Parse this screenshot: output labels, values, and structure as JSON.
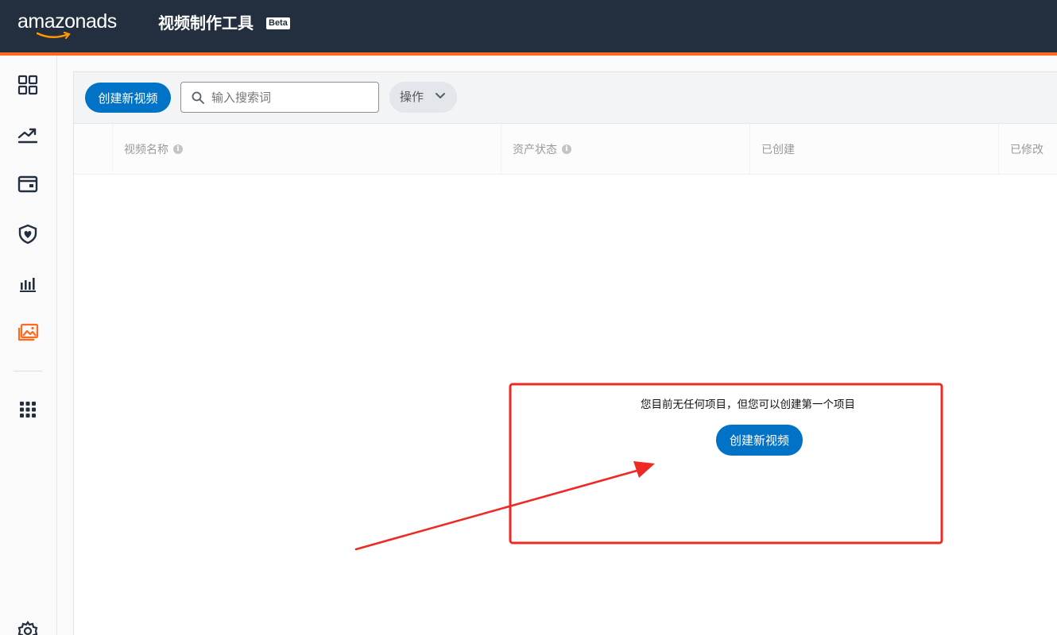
{
  "header": {
    "logo_text": "amazonads",
    "app_title": "视频制作工具",
    "beta_label": "Beta"
  },
  "sidebar": {
    "items": [
      {
        "icon": "dashboard-icon"
      },
      {
        "icon": "trending-up-icon"
      },
      {
        "icon": "wallet-icon"
      },
      {
        "icon": "brand-safety-shield-icon"
      },
      {
        "icon": "bar-chart-icon"
      },
      {
        "icon": "creative-assets-icon",
        "active": true
      },
      {
        "icon": "apps-grid-icon"
      },
      {
        "icon": "settings-gear-icon"
      }
    ]
  },
  "toolbar": {
    "create_button_label": "创建新视频",
    "search_placeholder": "输入搜索词",
    "actions_label": "操作"
  },
  "table": {
    "columns": [
      {
        "label": "视频名称",
        "info": true
      },
      {
        "label": "资产状态",
        "info": true
      },
      {
        "label": "已创建",
        "info": false
      },
      {
        "label": "已修改",
        "info": false
      }
    ]
  },
  "empty_state": {
    "message": "您目前无任何项目，但您可以创建第一个项目",
    "create_button_label": "创建新视频"
  },
  "colors": {
    "header_bg": "#232f3e",
    "accent_orange": "#ff6a1f",
    "primary_blue": "#0073c7",
    "annotation_red": "#ee2a24"
  }
}
